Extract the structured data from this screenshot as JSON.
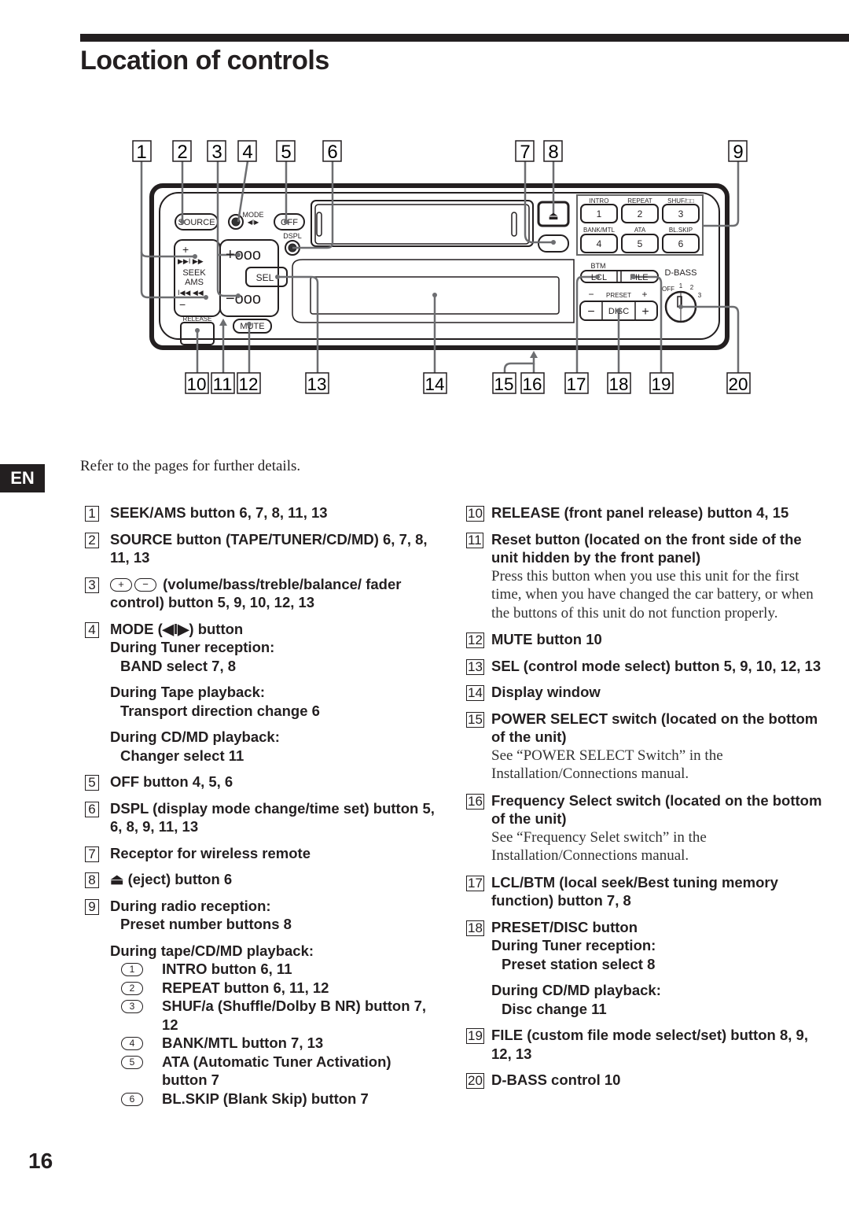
{
  "page": {
    "title": "Location of controls",
    "language_tab": "EN",
    "intro": "Refer to the pages for further details.",
    "page_number": "16"
  },
  "diagram": {
    "callouts_top": [
      "1",
      "2",
      "3",
      "4",
      "5",
      "6",
      "7",
      "8",
      "9"
    ],
    "callouts_bottom": [
      "10",
      "11",
      "12",
      "13",
      "14",
      "15",
      "16",
      "17",
      "18",
      "19",
      "20"
    ],
    "labels": {
      "source": "SOURCE",
      "mode": "MODE",
      "off": "OFF",
      "dspl": "DSPL",
      "seek": "SEEK",
      "ams": "AMS",
      "sel": "SEL",
      "release": "RELEASE",
      "mute": "MUTE",
      "btm": "BTM",
      "lcl": "LCL",
      "file": "FILE",
      "dbass": "D-BASS",
      "preset": "PRESET",
      "disc": "DISC",
      "dbass_off": "OFF",
      "dbass_1": "1",
      "dbass_2": "2",
      "dbass_3": "3"
    },
    "preset_buttons": [
      {
        "num": "1",
        "label": "INTRO"
      },
      {
        "num": "2",
        "label": "REPEAT"
      },
      {
        "num": "3",
        "label": "SHUF/□□"
      },
      {
        "num": "4",
        "label": "BANK/MTL"
      },
      {
        "num": "5",
        "label": "ATA"
      },
      {
        "num": "6",
        "label": "BL.SKIP"
      }
    ]
  },
  "items_left": {
    "i1": {
      "num": "1",
      "text": "SEEK/AMS button 6, 7, 8, 11, 13"
    },
    "i2": {
      "num": "2",
      "text": "SOURCE button (TAPE/TUNER/CD/MD) 6, 7, 8, 11, 13"
    },
    "i3": {
      "num": "3",
      "plus": "+",
      "minus": "−",
      "text": "(volume/bass/treble/balance/ fader control) button 5, 9, 10, 12, 13"
    },
    "i4": {
      "num": "4",
      "text": "MODE (◀I▶) button",
      "h1": "During Tuner reception:",
      "s1": "BAND select 7, 8",
      "h2": "During Tape playback:",
      "s2": "Transport direction change 6",
      "h3": "During CD/MD playback:",
      "s3": "Changer select 11"
    },
    "i5": {
      "num": "5",
      "text": "OFF button 4, 5, 6"
    },
    "i6": {
      "num": "6",
      "text": "DSPL (display mode change/time set) button 5, 6, 8, 9, 11, 13"
    },
    "i7": {
      "num": "7",
      "text": "Receptor for wireless remote"
    },
    "i8": {
      "num": "8",
      "text": "⏏ (eject) button 6"
    },
    "i9": {
      "num": "9",
      "h1": "During radio reception:",
      "s1": "Preset number buttons 8",
      "h2": "During tape/CD/MD playback:",
      "sub": [
        {
          "n": "1",
          "t": "INTRO button 6, 11"
        },
        {
          "n": "2",
          "t": "REPEAT button 6, 11, 12"
        },
        {
          "n": "3",
          "t": "SHUF/a    (Shuffle/Dolby B NR) button 7, 12"
        },
        {
          "n": "4",
          "t": "BANK/MTL button 7, 13"
        },
        {
          "n": "5",
          "t": "ATA (Automatic Tuner Activation) button 7"
        },
        {
          "n": "6",
          "t": "BL.SKIP (Blank Skip) button 7"
        }
      ]
    }
  },
  "items_right": {
    "i10": {
      "num": "10",
      "text": "RELEASE (front panel release) button 4, 15"
    },
    "i11": {
      "num": "11",
      "text": "Reset button (located on the front side of the unit hidden by the front panel)",
      "note": "Press this button when you use this unit for the first time, when you have changed the car battery, or when the buttons of this unit do not function properly."
    },
    "i12": {
      "num": "12",
      "text": "MUTE button 10"
    },
    "i13": {
      "num": "13",
      "text": "SEL (control mode select) button 5, 9, 10, 12, 13"
    },
    "i14": {
      "num": "14",
      "text": "Display window"
    },
    "i15": {
      "num": "15",
      "text": "POWER SELECT switch (located on the bottom of the unit)",
      "note": "See “POWER SELECT Switch” in the Installation/Connections manual."
    },
    "i16": {
      "num": "16",
      "text": "Frequency Select switch (located on the bottom of the unit)",
      "note": "See “Frequency Selet switch” in the Installation/Connections manual."
    },
    "i17": {
      "num": "17",
      "text": "LCL/BTM (local seek/Best tuning memory function) button 7, 8"
    },
    "i18": {
      "num": "18",
      "text": "PRESET/DISC button",
      "h1": "During Tuner reception:",
      "s1": "Preset station select   8",
      "h2": "During CD/MD playback:",
      "s2": "Disc change   11"
    },
    "i19": {
      "num": "19",
      "text": "FILE (custom file mode select/set) button 8, 9, 12, 13"
    },
    "i20": {
      "num": "20",
      "text": "D-BASS control 10"
    }
  }
}
